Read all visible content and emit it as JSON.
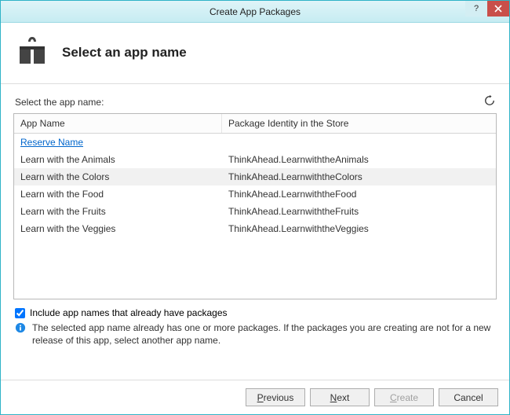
{
  "titlebar": {
    "title": "Create App Packages"
  },
  "header": {
    "title": "Select an app name"
  },
  "content": {
    "prompt": "Select the app name:",
    "col_app_name": "App Name",
    "col_pkg_identity": "Package Identity in the Store",
    "reserve_link": "Reserve Name",
    "rows": [
      {
        "name": "Learn with the Animals",
        "identity": "ThinkAhead.LearnwiththeAnimals"
      },
      {
        "name": "Learn with the Colors",
        "identity": "ThinkAhead.LearnwiththeColors"
      },
      {
        "name": "Learn with the Food",
        "identity": "ThinkAhead.LearnwiththeFood"
      },
      {
        "name": "Learn with the Fruits",
        "identity": "ThinkAhead.LearnwiththeFruits"
      },
      {
        "name": "Learn with the Veggies",
        "identity": "ThinkAhead.LearnwiththeVeggies"
      }
    ],
    "selected_index": 1,
    "include_checkbox_label": "Include app names that already have packages",
    "include_checkbox_checked": true,
    "info_text": "The selected app name already has one or more packages. If the packages you are creating are not for a new release of this app, select another app name."
  },
  "footer": {
    "previous": "Previous",
    "next": "Next",
    "create": "Create",
    "cancel": "Cancel"
  }
}
